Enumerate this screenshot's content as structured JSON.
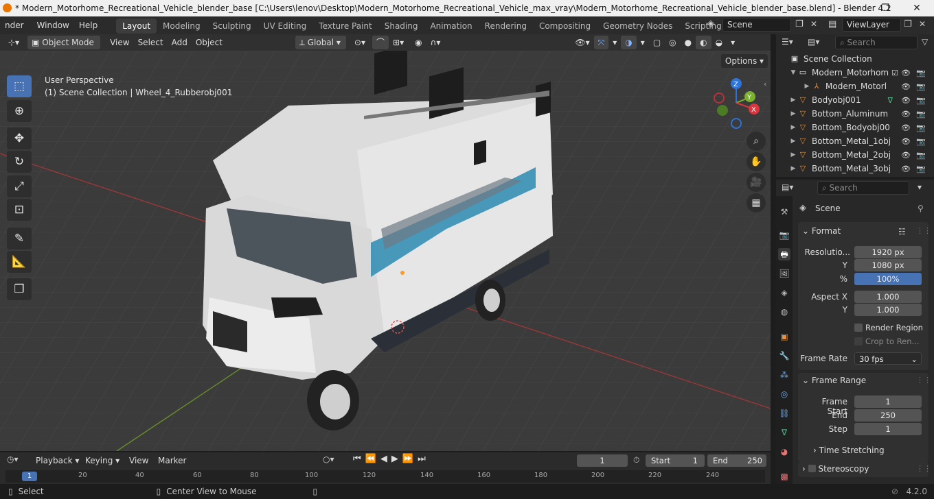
{
  "window": {
    "title": "* Modern_Motorhome_Recreational_Vehicle_blender_base [C:\\Users\\lenov\\Desktop\\Modern_Motorhome_Recreational_Vehicle_max_vray\\Modern_Motorhome_Recreational_Vehicle_blender_base.blend] - Blender 4.2",
    "minimize": "—",
    "maximize": "❐",
    "close": "✕"
  },
  "menu": [
    "nder",
    "Window",
    "Help"
  ],
  "workspaces": [
    "Layout",
    "Modeling",
    "Sculpting",
    "UV Editing",
    "Texture Paint",
    "Shading",
    "Animation",
    "Rendering",
    "Compositing",
    "Geometry Nodes",
    "Scripting"
  ],
  "scene_name": "Scene",
  "view_layer": "ViewLayer",
  "viewport_header": {
    "mode": "Object Mode",
    "menus": [
      "View",
      "Select",
      "Add",
      "Object"
    ],
    "transform": "Global",
    "options": "Options"
  },
  "viewport": {
    "perspective": "User Perspective",
    "context": "(1) Scene Collection | Wheel_4_Rubberobj001"
  },
  "gizmo": {
    "z": "Z",
    "y": "Y",
    "x": "X"
  },
  "outliner": {
    "search_placeholder": "Search",
    "root": "Scene Collection",
    "rows": [
      {
        "label": "Modern_Motorhom",
        "icon": "collection-icon"
      },
      {
        "label": "Modern_Motorl",
        "icon": "armature-icon"
      },
      {
        "label": "Bodyobj001",
        "icon": "mesh-icon"
      },
      {
        "label": "Bottom_Aluminum",
        "icon": "mesh-icon"
      },
      {
        "label": "Bottom_Bodyobj00",
        "icon": "mesh-icon"
      },
      {
        "label": "Bottom_Metal_1obj",
        "icon": "mesh-icon"
      },
      {
        "label": "Bottom_Metal_2obj",
        "icon": "mesh-icon"
      },
      {
        "label": "Bottom_Metal_3obj",
        "icon": "mesh-icon"
      }
    ]
  },
  "properties": {
    "search_placeholder": "Search",
    "context": "Scene",
    "format": {
      "title": "Format",
      "res_x_label": "Resolutio...",
      "res_x": "1920 px",
      "res_y_label": "Y",
      "res_y": "1080 px",
      "pct_label": "%",
      "pct": "100%",
      "aspect_x_label": "Aspect X",
      "aspect_x": "1.000",
      "aspect_y_label": "Y",
      "aspect_y": "1.000",
      "render_region": "Render Region",
      "crop": "Crop to Ren...",
      "frame_rate_label": "Frame Rate",
      "frame_rate": "30 fps"
    },
    "frame_range": {
      "title": "Frame Range",
      "start_label": "Frame Start",
      "start": "1",
      "end_label": "End",
      "end": "250",
      "step_label": "Step",
      "step": "1"
    },
    "time_stretching": "Time Stretching",
    "stereoscopy": "Stereoscopy"
  },
  "timeline": {
    "menus": [
      "Playback",
      "Keying",
      "View",
      "Marker"
    ],
    "current_frame": "1",
    "start_label": "Start",
    "start": "1",
    "end_label": "End",
    "end": "250",
    "ruler": [
      "1",
      "20",
      "40",
      "60",
      "80",
      "100",
      "120",
      "140",
      "160",
      "180",
      "200",
      "220",
      "240"
    ]
  },
  "statusbar": {
    "select": "Select",
    "center": "Center View to Mouse",
    "version": "4.2.0"
  }
}
